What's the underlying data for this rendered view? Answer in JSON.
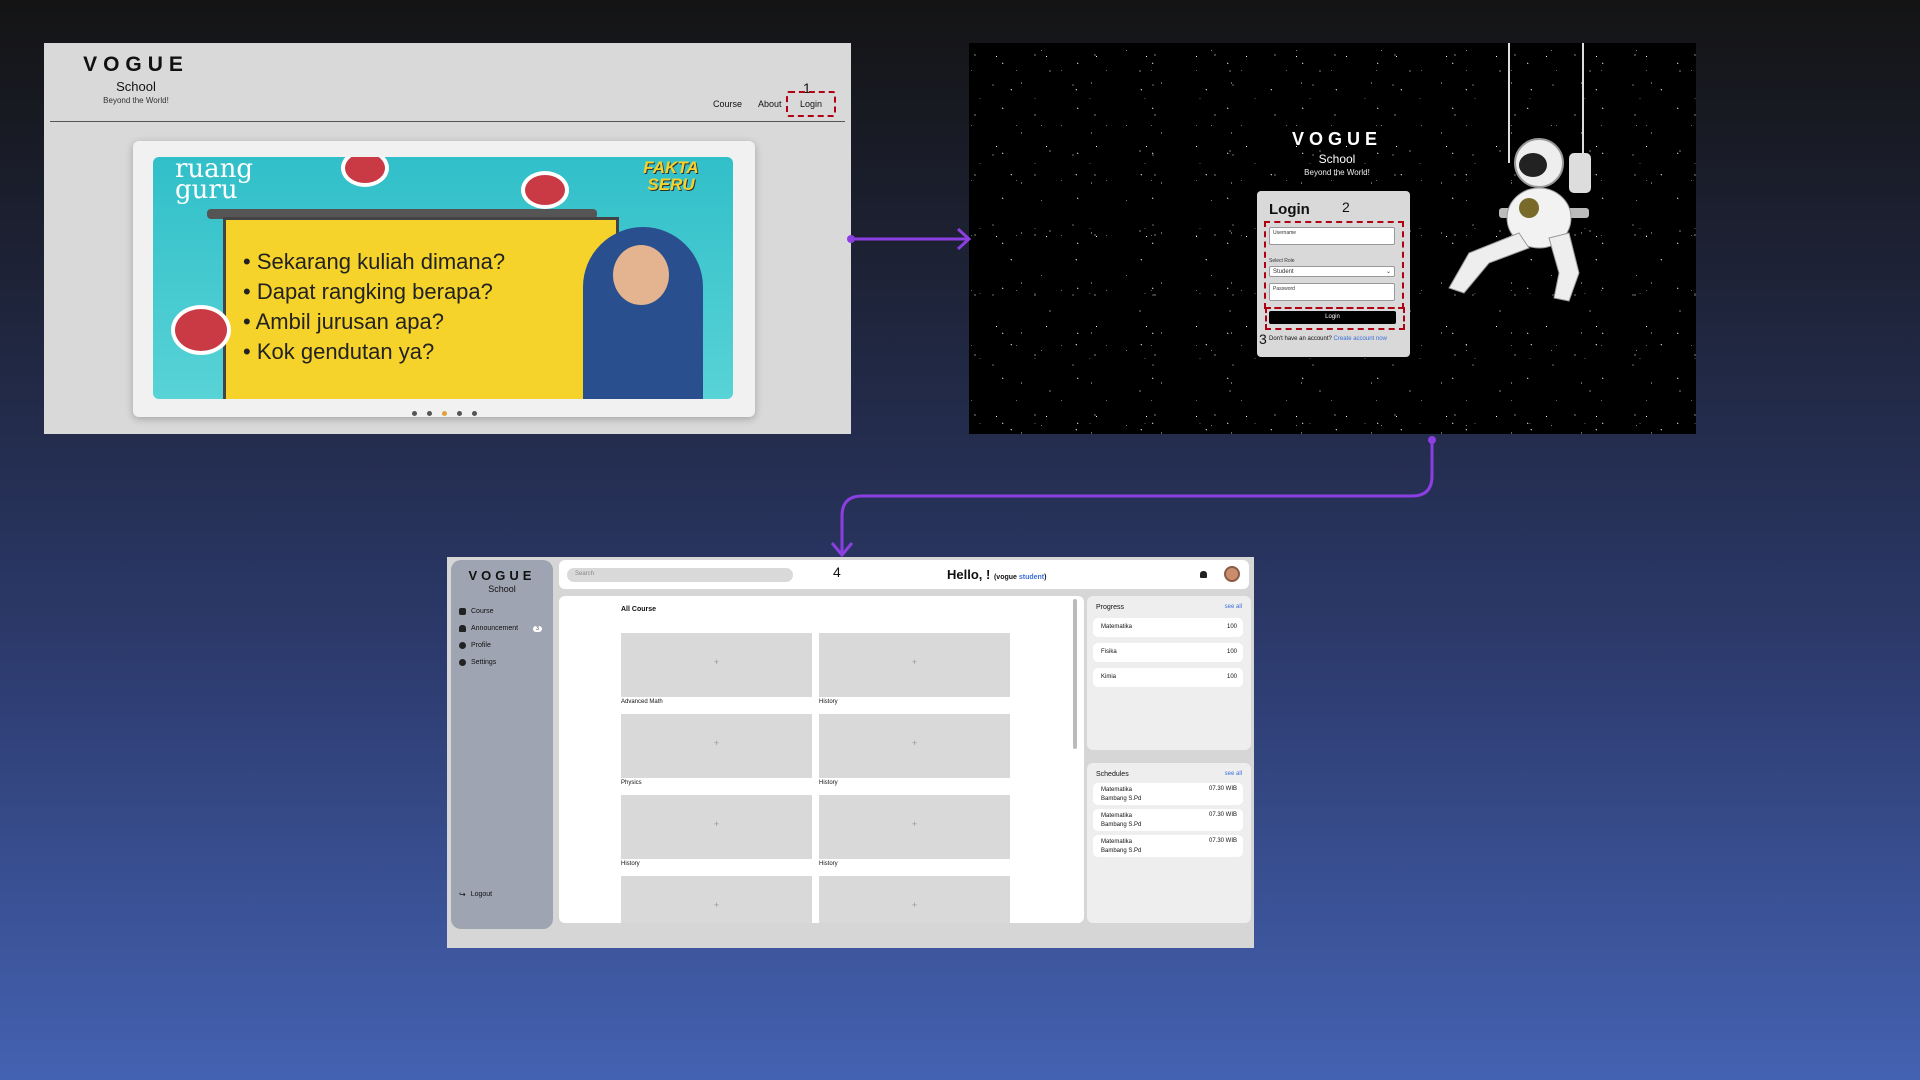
{
  "landing": {
    "brand": {
      "title": "VOGUE",
      "subtitle": "School",
      "tagline": "Beyond the World!"
    },
    "nav": [
      {
        "label": "Course"
      },
      {
        "label": "About"
      },
      {
        "label": "Login"
      }
    ],
    "step_label": "1",
    "banner": {
      "logo": "ruang guru",
      "badge": "FAKTA SERU",
      "bullets": [
        "Sekarang kuliah dimana?",
        "Dapat rangking berapa?",
        "Ambil jurusan apa?",
        "Kok gendutan ya?"
      ]
    },
    "carousel": {
      "count": 5,
      "active": 3
    }
  },
  "login": {
    "brand": {
      "title": "VOGUE",
      "subtitle": "School",
      "tagline": "Beyond the World!"
    },
    "heading": "Login",
    "step_form": "2",
    "step_button": "3",
    "username_label": "Username",
    "role_label": "Select Role",
    "role_value": "Student",
    "password_label": "Password",
    "submit_label": "Login",
    "footer_text": "Don't have an account?",
    "footer_link": "Create account now"
  },
  "dashboard": {
    "brand": {
      "title": "VOGUE",
      "subtitle": "School"
    },
    "step_label": "4",
    "sidebar": {
      "items": [
        {
          "label": "Course",
          "icon": "book-icon"
        },
        {
          "label": "Announcement",
          "icon": "bell-icon",
          "badge": "3"
        },
        {
          "label": "Profile",
          "icon": "user-icon"
        },
        {
          "label": "Settings",
          "icon": "gear-icon"
        }
      ],
      "logout": "Logout"
    },
    "search_placeholder": "Search",
    "greeting": "Hello, !",
    "role_prefix": "(vogue ",
    "role_name": "student",
    "role_suffix": ")",
    "courses_title": "All Course",
    "courses": [
      "Advanced Math",
      "History",
      "Physics",
      "History",
      "History",
      "History",
      "",
      ""
    ],
    "progress": {
      "title": "Progress",
      "see_all": "see all",
      "rows": [
        {
          "subject": "Matematika",
          "value": "100"
        },
        {
          "subject": "Fisika",
          "value": "100"
        },
        {
          "subject": "Kimia",
          "value": "100"
        }
      ]
    },
    "schedules": {
      "title": "Schedules",
      "see_all": "see all",
      "rows": [
        {
          "subject": "Matematika",
          "teacher": "Bambang S.Pd",
          "time": "07.30 WIB"
        },
        {
          "subject": "Matematika",
          "teacher": "Bambang S.Pd",
          "time": "07.30 WIB"
        },
        {
          "subject": "Matematika",
          "teacher": "Bambang S.Pd",
          "time": "07.30 WIB"
        }
      ]
    }
  },
  "colors": {
    "flow_arrow": "#8b3fe0",
    "highlight": "#b00014",
    "link": "#3a6fd8"
  }
}
